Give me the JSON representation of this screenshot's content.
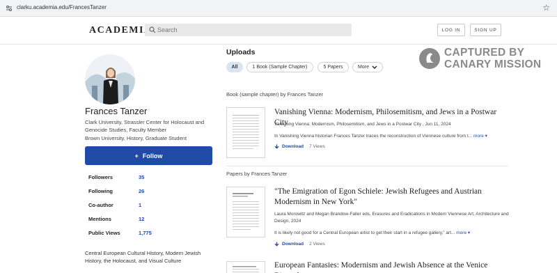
{
  "browser": {
    "url": "clarku.academia.edu/FrancesTanzer"
  },
  "nav": {
    "logo": "ACADEMIA",
    "search_placeholder": "Search",
    "login": "LOG IN",
    "signup": "SIGN UP"
  },
  "profile": {
    "name": "Frances Tanzer",
    "affiliation_1": "Clark University, Strassler Center for Holocaust and Genocide Studies, Faculty Member",
    "affiliation_2": "Brown University, History, Graduate Student",
    "follow_label": "Follow",
    "stats": [
      {
        "label": "Followers",
        "value": "35"
      },
      {
        "label": "Following",
        "value": "26"
      },
      {
        "label": "Co-author",
        "value": "1"
      },
      {
        "label": "Mentions",
        "value": "12"
      },
      {
        "label": "Public Views",
        "value": "1,775"
      }
    ],
    "interests": "Central European Cultural History, Modern Jewish History, the Holocaust, and Visual Culture"
  },
  "uploads": {
    "title": "Uploads",
    "filters": [
      "All",
      "1 Book (Sample Chapter)",
      "5 Papers",
      "More"
    ],
    "watermark": {
      "line1": "CAPTURED BY",
      "line2": "CANARY MISSION"
    },
    "book_section": "Book (sample chapter) by Frances Tanzer",
    "papers_section": "Papers by Frances Tanzer",
    "works": [
      {
        "title": "Vanishing Vienna: Modernism, Philosemitism, and Jews in a Postwar City",
        "meta": "Vanishing Vienna: Modernism, Philosemitism, and Jews in a Postwar City , Jun 11, 2024",
        "snippet": "In Vanishing Vienna historian Frances Tanzer traces the reconstruction of Viennese culture from t...",
        "more": "more",
        "download": "Download",
        "views": "7 Views"
      },
      {
        "title": "\"The Emigration of Egon Schiele: Jewish Refugees and Austrian Modernism in New York\"",
        "meta": "Laura Morowitz and Megan Brandow-Faller eds, Erasures and Eradications in Modern Viennese Art, Architecture and Design, 2024",
        "snippet": "It is likely not good for a Central European artist to get their start in a refugee gallery,\" art...",
        "more": "more",
        "download": "Download",
        "views": "2 Views"
      },
      {
        "title": "European Fantasies: Modernism and Jewish Absence at the Venice Biennale"
      }
    ]
  }
}
